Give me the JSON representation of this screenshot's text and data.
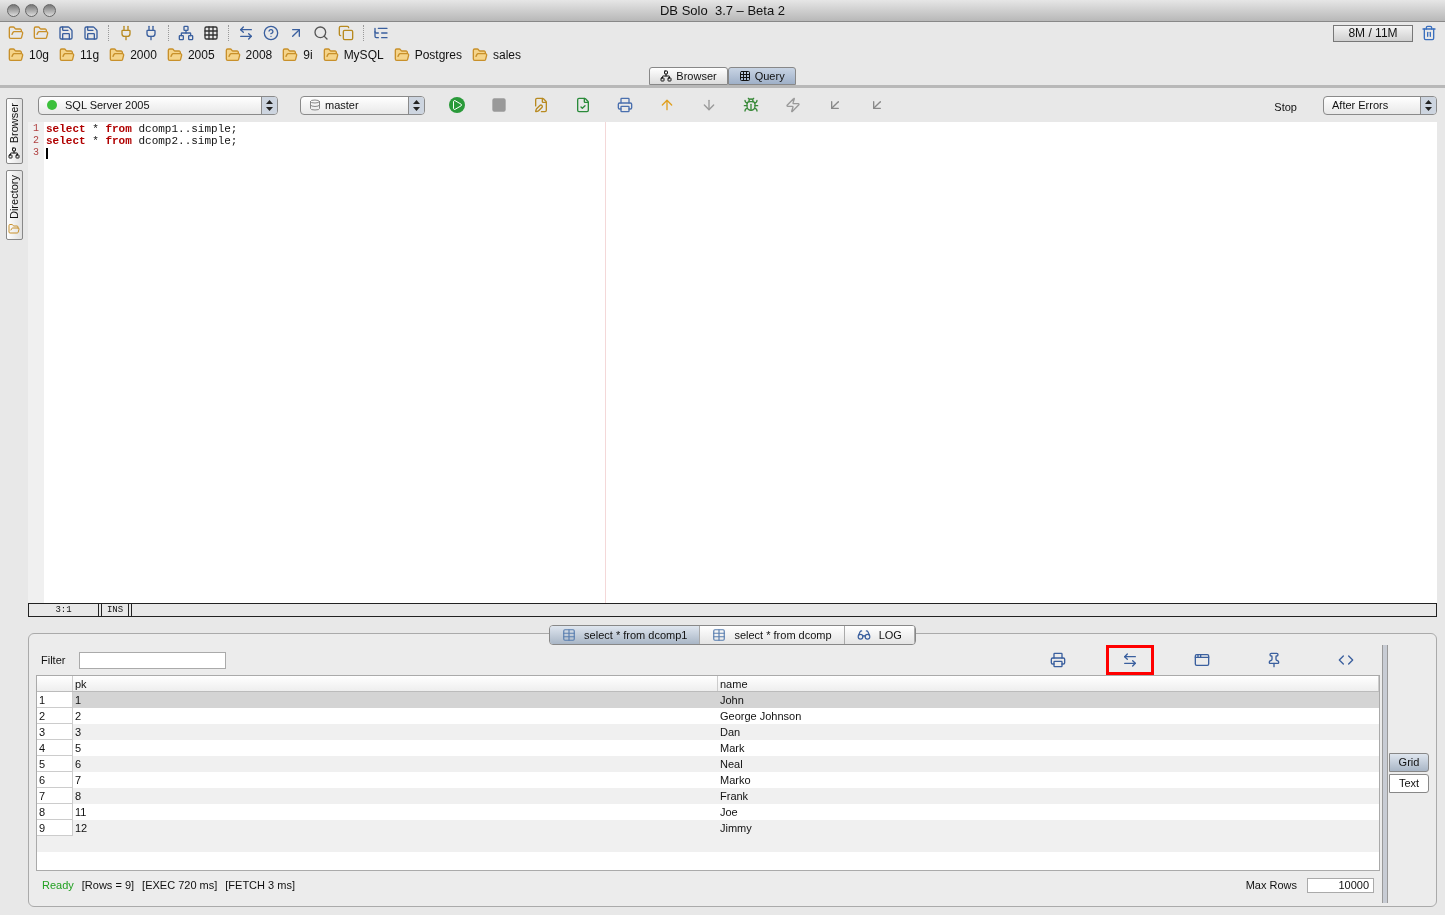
{
  "window": {
    "title": "DB Solo  3.7 – Beta 2"
  },
  "memory": "8M / 11M",
  "bookmarks": [
    "10g",
    "11g",
    "2000",
    "2005",
    "2008",
    "9i",
    "MySQL",
    "Postgres",
    "sales"
  ],
  "view_tabs": [
    {
      "label": "Browser",
      "selected": false
    },
    {
      "label": "Query",
      "selected": true
    }
  ],
  "side_tabs": [
    {
      "label": "Browser",
      "selected": false
    },
    {
      "label": "Directory",
      "selected": false
    }
  ],
  "query_toolbar": {
    "connection": "SQL Server 2005",
    "database": "master",
    "stop_label": "Stop",
    "error_mode": "After Errors"
  },
  "editor": {
    "lines": [
      {
        "number": "1",
        "tokens": [
          {
            "kind": "keyword",
            "text": "select"
          },
          {
            "kind": "plain",
            "text": " * "
          },
          {
            "kind": "keyword",
            "text": "from"
          },
          {
            "kind": "plain",
            "text": " dcomp1..simple;"
          }
        ]
      },
      {
        "number": "2",
        "tokens": [
          {
            "kind": "keyword",
            "text": "select"
          },
          {
            "kind": "plain",
            "text": " * "
          },
          {
            "kind": "keyword",
            "text": "from"
          },
          {
            "kind": "plain",
            "text": " dcomp2..simple;"
          }
        ]
      },
      {
        "number": "3",
        "cursor": true
      }
    ],
    "position": "3:1",
    "mode": "INS"
  },
  "result_tabs": [
    {
      "label": "select * from dcomp1",
      "selected": true,
      "kind": "table"
    },
    {
      "label": "select * from dcomp",
      "selected": false,
      "kind": "table"
    },
    {
      "label": "LOG",
      "selected": false,
      "kind": "log"
    }
  ],
  "filter": {
    "label": "Filter"
  },
  "result_tools": [
    {
      "kind": "print",
      "highlighted": false
    },
    {
      "kind": "swap",
      "highlighted": true
    },
    {
      "kind": "window",
      "highlighted": false
    },
    {
      "kind": "pin",
      "highlighted": false
    },
    {
      "kind": "code",
      "highlighted": false
    }
  ],
  "table": {
    "columns": [
      "pk",
      "name"
    ],
    "rows": [
      {
        "index": "1",
        "pk": "1",
        "name": "John",
        "selected": true
      },
      {
        "index": "2",
        "pk": "2",
        "name": "George Johnson",
        "selected": false
      },
      {
        "index": "3",
        "pk": "3",
        "name": "Dan",
        "selected": false
      },
      {
        "index": "4",
        "pk": "5",
        "name": "Mark",
        "selected": false
      },
      {
        "index": "5",
        "pk": "6",
        "name": "Neal",
        "selected": false
      },
      {
        "index": "6",
        "pk": "7",
        "name": "Marko",
        "selected": false
      },
      {
        "index": "7",
        "pk": "8",
        "name": "Frank",
        "selected": false
      },
      {
        "index": "8",
        "pk": "11",
        "name": "Joe",
        "selected": false
      },
      {
        "index": "9",
        "pk": "12",
        "name": "Jimmy",
        "selected": false
      }
    ]
  },
  "view_modes": [
    {
      "label": "Grid",
      "selected": true
    },
    {
      "label": "Text",
      "selected": false
    }
  ],
  "status_bar": {
    "state": "Ready",
    "rows": "[Rows = 9]",
    "exec": "[EXEC 720 ms]",
    "fetch": "[FETCH 3 ms]",
    "max_rows_label": "Max Rows",
    "max_rows": "10000"
  }
}
